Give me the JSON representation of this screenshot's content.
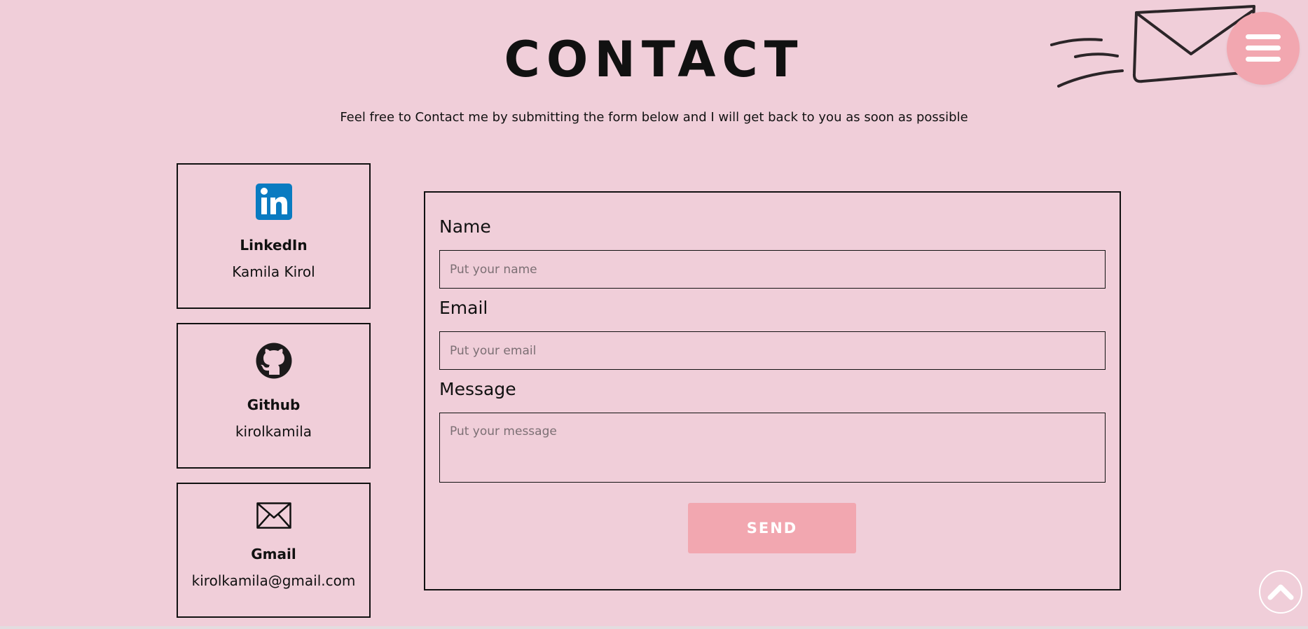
{
  "page": {
    "title": "CONTACT",
    "subtitle": "Feel free to Contact me by submitting the form below and I will get back to you as soon as possible"
  },
  "icons": {
    "envelope_doodle": "envelope-doodle-icon",
    "menu": "hamburger-menu-icon",
    "scroll_top": "chevron-up-icon"
  },
  "contacts": [
    {
      "icon": "linkedin-icon",
      "title": "LinkedIn",
      "value": "Kamila Kirol"
    },
    {
      "icon": "github-icon",
      "title": "Github",
      "value": "kirolkamila"
    },
    {
      "icon": "mail-icon",
      "title": "Gmail",
      "value": "kirolkamila@gmail.com"
    }
  ],
  "form": {
    "name_label": "Name",
    "name_placeholder": "Put your name",
    "name_value": "",
    "email_label": "Email",
    "email_placeholder": "Put your email",
    "email_value": "",
    "message_label": "Message",
    "message_placeholder": "Put your message",
    "message_value": "",
    "send_label": "SEND"
  },
  "colors": {
    "background": "#f0ced9",
    "accent": "#f2a7b0",
    "text": "#111111",
    "linkedin": "#0a7bc1"
  }
}
